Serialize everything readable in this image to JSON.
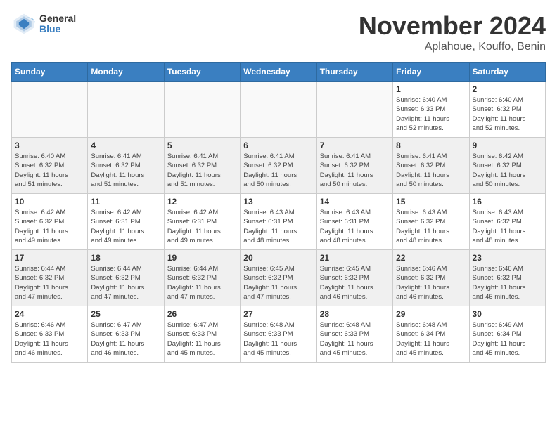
{
  "logo": {
    "general": "General",
    "blue": "Blue"
  },
  "title": "November 2024",
  "location": "Aplahoue, Kouffo, Benin",
  "weekdays": [
    "Sunday",
    "Monday",
    "Tuesday",
    "Wednesday",
    "Thursday",
    "Friday",
    "Saturday"
  ],
  "weeks": [
    [
      {
        "day": "",
        "info": ""
      },
      {
        "day": "",
        "info": ""
      },
      {
        "day": "",
        "info": ""
      },
      {
        "day": "",
        "info": ""
      },
      {
        "day": "",
        "info": ""
      },
      {
        "day": "1",
        "info": "Sunrise: 6:40 AM\nSunset: 6:33 PM\nDaylight: 11 hours\nand 52 minutes."
      },
      {
        "day": "2",
        "info": "Sunrise: 6:40 AM\nSunset: 6:32 PM\nDaylight: 11 hours\nand 52 minutes."
      }
    ],
    [
      {
        "day": "3",
        "info": "Sunrise: 6:40 AM\nSunset: 6:32 PM\nDaylight: 11 hours\nand 51 minutes."
      },
      {
        "day": "4",
        "info": "Sunrise: 6:41 AM\nSunset: 6:32 PM\nDaylight: 11 hours\nand 51 minutes."
      },
      {
        "day": "5",
        "info": "Sunrise: 6:41 AM\nSunset: 6:32 PM\nDaylight: 11 hours\nand 51 minutes."
      },
      {
        "day": "6",
        "info": "Sunrise: 6:41 AM\nSunset: 6:32 PM\nDaylight: 11 hours\nand 50 minutes."
      },
      {
        "day": "7",
        "info": "Sunrise: 6:41 AM\nSunset: 6:32 PM\nDaylight: 11 hours\nand 50 minutes."
      },
      {
        "day": "8",
        "info": "Sunrise: 6:41 AM\nSunset: 6:32 PM\nDaylight: 11 hours\nand 50 minutes."
      },
      {
        "day": "9",
        "info": "Sunrise: 6:42 AM\nSunset: 6:32 PM\nDaylight: 11 hours\nand 50 minutes."
      }
    ],
    [
      {
        "day": "10",
        "info": "Sunrise: 6:42 AM\nSunset: 6:32 PM\nDaylight: 11 hours\nand 49 minutes."
      },
      {
        "day": "11",
        "info": "Sunrise: 6:42 AM\nSunset: 6:31 PM\nDaylight: 11 hours\nand 49 minutes."
      },
      {
        "day": "12",
        "info": "Sunrise: 6:42 AM\nSunset: 6:31 PM\nDaylight: 11 hours\nand 49 minutes."
      },
      {
        "day": "13",
        "info": "Sunrise: 6:43 AM\nSunset: 6:31 PM\nDaylight: 11 hours\nand 48 minutes."
      },
      {
        "day": "14",
        "info": "Sunrise: 6:43 AM\nSunset: 6:31 PM\nDaylight: 11 hours\nand 48 minutes."
      },
      {
        "day": "15",
        "info": "Sunrise: 6:43 AM\nSunset: 6:32 PM\nDaylight: 11 hours\nand 48 minutes."
      },
      {
        "day": "16",
        "info": "Sunrise: 6:43 AM\nSunset: 6:32 PM\nDaylight: 11 hours\nand 48 minutes."
      }
    ],
    [
      {
        "day": "17",
        "info": "Sunrise: 6:44 AM\nSunset: 6:32 PM\nDaylight: 11 hours\nand 47 minutes."
      },
      {
        "day": "18",
        "info": "Sunrise: 6:44 AM\nSunset: 6:32 PM\nDaylight: 11 hours\nand 47 minutes."
      },
      {
        "day": "19",
        "info": "Sunrise: 6:44 AM\nSunset: 6:32 PM\nDaylight: 11 hours\nand 47 minutes."
      },
      {
        "day": "20",
        "info": "Sunrise: 6:45 AM\nSunset: 6:32 PM\nDaylight: 11 hours\nand 47 minutes."
      },
      {
        "day": "21",
        "info": "Sunrise: 6:45 AM\nSunset: 6:32 PM\nDaylight: 11 hours\nand 46 minutes."
      },
      {
        "day": "22",
        "info": "Sunrise: 6:46 AM\nSunset: 6:32 PM\nDaylight: 11 hours\nand 46 minutes."
      },
      {
        "day": "23",
        "info": "Sunrise: 6:46 AM\nSunset: 6:32 PM\nDaylight: 11 hours\nand 46 minutes."
      }
    ],
    [
      {
        "day": "24",
        "info": "Sunrise: 6:46 AM\nSunset: 6:33 PM\nDaylight: 11 hours\nand 46 minutes."
      },
      {
        "day": "25",
        "info": "Sunrise: 6:47 AM\nSunset: 6:33 PM\nDaylight: 11 hours\nand 46 minutes."
      },
      {
        "day": "26",
        "info": "Sunrise: 6:47 AM\nSunset: 6:33 PM\nDaylight: 11 hours\nand 45 minutes."
      },
      {
        "day": "27",
        "info": "Sunrise: 6:48 AM\nSunset: 6:33 PM\nDaylight: 11 hours\nand 45 minutes."
      },
      {
        "day": "28",
        "info": "Sunrise: 6:48 AM\nSunset: 6:33 PM\nDaylight: 11 hours\nand 45 minutes."
      },
      {
        "day": "29",
        "info": "Sunrise: 6:48 AM\nSunset: 6:34 PM\nDaylight: 11 hours\nand 45 minutes."
      },
      {
        "day": "30",
        "info": "Sunrise: 6:49 AM\nSunset: 6:34 PM\nDaylight: 11 hours\nand 45 minutes."
      }
    ]
  ]
}
